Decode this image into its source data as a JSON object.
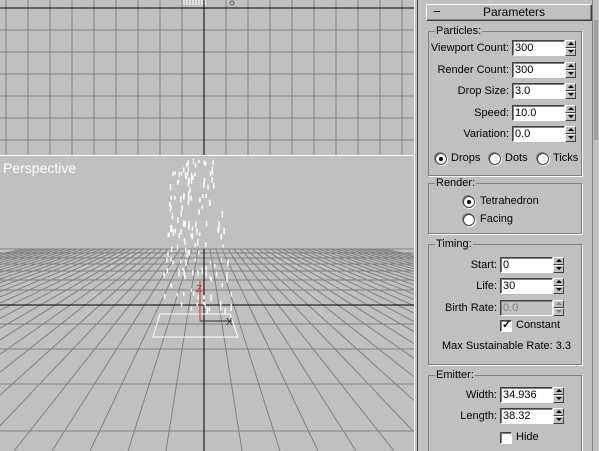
{
  "viewports": {
    "top": {
      "label": ""
    },
    "perspective": {
      "label": "Perspective",
      "axis_labels": {
        "z": "Z",
        "x": "X"
      }
    }
  },
  "colors": {
    "grid_line": "#808080",
    "axis": "#000000",
    "particles": "#ffffff",
    "z_axis": "#c03030"
  },
  "panel": {
    "rollout_title": "Parameters",
    "particles": {
      "title": "Particles:",
      "viewport_count": {
        "label": "Viewport Count:",
        "value": "300"
      },
      "render_count": {
        "label": "Render Count:",
        "value": "300"
      },
      "drop_size": {
        "label": "Drop Size:",
        "value": "3.0"
      },
      "speed": {
        "label": "Speed:",
        "value": "10.0"
      },
      "variation": {
        "label": "Variation:",
        "value": "0.0"
      },
      "shape_options": [
        {
          "label": "Drops",
          "selected": true
        },
        {
          "label": "Dots",
          "selected": false
        },
        {
          "label": "Ticks",
          "selected": false
        }
      ]
    },
    "render": {
      "title": "Render:",
      "options": [
        {
          "label": "Tetrahedron",
          "selected": true
        },
        {
          "label": "Facing",
          "selected": false
        }
      ]
    },
    "timing": {
      "title": "Timing:",
      "start": {
        "label": "Start:",
        "value": "0"
      },
      "life": {
        "label": "Life:",
        "value": "30"
      },
      "birth_rate": {
        "label": "Birth Rate:",
        "value": "0.0"
      },
      "constant": {
        "label": "Constant",
        "checked": true
      },
      "max_rate": "Max Sustainable Rate: 3.3"
    },
    "emitter": {
      "title": "Emitter:",
      "width": {
        "label": "Width:",
        "value": "34.936"
      },
      "length": {
        "label": "Length:",
        "value": "38.32"
      },
      "hide": {
        "label": "Hide",
        "checked": false
      }
    }
  }
}
